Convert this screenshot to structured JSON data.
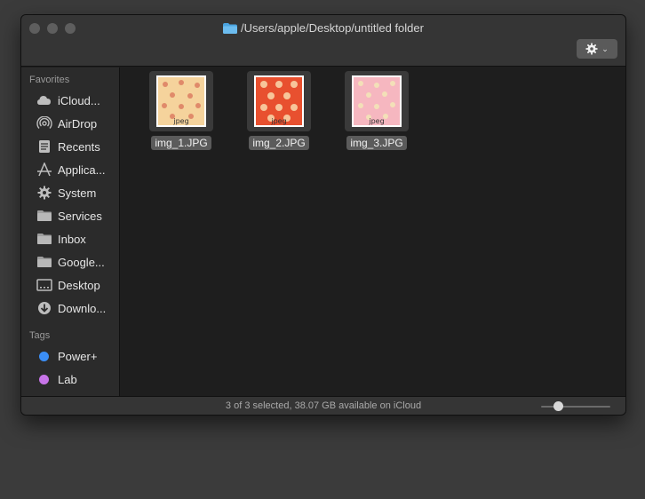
{
  "window": {
    "title": "/Users/apple/Desktop/untitled folder"
  },
  "toolbar": {
    "action_icon": "gear-icon"
  },
  "sidebar": {
    "favorites_header": "Favorites",
    "favorites": [
      {
        "label": "iCloud...",
        "icon": "cloud-icon"
      },
      {
        "label": "AirDrop",
        "icon": "airdrop-icon"
      },
      {
        "label": "Recents",
        "icon": "recents-icon"
      },
      {
        "label": "Applica...",
        "icon": "applications-icon"
      },
      {
        "label": "System",
        "icon": "gear-icon"
      },
      {
        "label": "Services",
        "icon": "folder-icon"
      },
      {
        "label": "Inbox",
        "icon": "folder-icon"
      },
      {
        "label": "Google...",
        "icon": "folder-icon"
      },
      {
        "label": "Desktop",
        "icon": "desktop-icon"
      },
      {
        "label": "Downlo...",
        "icon": "download-icon"
      }
    ],
    "tags_header": "Tags",
    "tags": [
      {
        "label": "Power+",
        "color": "#3b8ef5"
      },
      {
        "label": "Lab",
        "color": "#c774e8"
      }
    ]
  },
  "files": [
    {
      "name": "img_1.JPG",
      "ext": "jpeg",
      "bg": "#f5d39c",
      "motif": "#e08a6a"
    },
    {
      "name": "img_2.JPG",
      "ext": "jpeg",
      "bg": "#e8502f",
      "motif": "#f7c59a"
    },
    {
      "name": "img_3.JPG",
      "ext": "jpeg",
      "bg": "#f6b7c0",
      "motif": "#f3e0b8"
    }
  ],
  "status": {
    "text": "3 of 3 selected, 38.07 GB available on iCloud",
    "icon_size_fraction": 0.25
  }
}
